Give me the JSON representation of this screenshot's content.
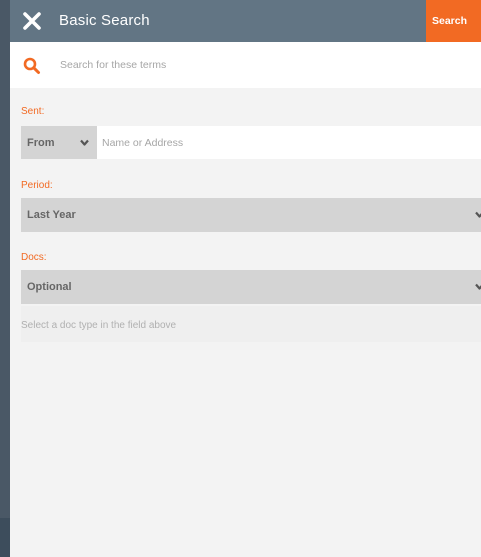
{
  "header": {
    "title": "Basic Search",
    "close_icon": "close-x-icon",
    "search_label": "Search"
  },
  "terms": {
    "icon": "search-icon",
    "placeholder": "Search for these terms",
    "value": ""
  },
  "sent": {
    "label": "Sent:",
    "direction_value": "From",
    "address_placeholder": "Name or Address",
    "address_value": ""
  },
  "period": {
    "label": "Period:",
    "value": "Last Year"
  },
  "docs": {
    "label": "Docs:",
    "value": "Optional",
    "hint": "Select a doc type in the field above"
  },
  "colors": {
    "accent": "#f26a23",
    "header": "#627584",
    "field_bg": "#d4d4d4"
  }
}
